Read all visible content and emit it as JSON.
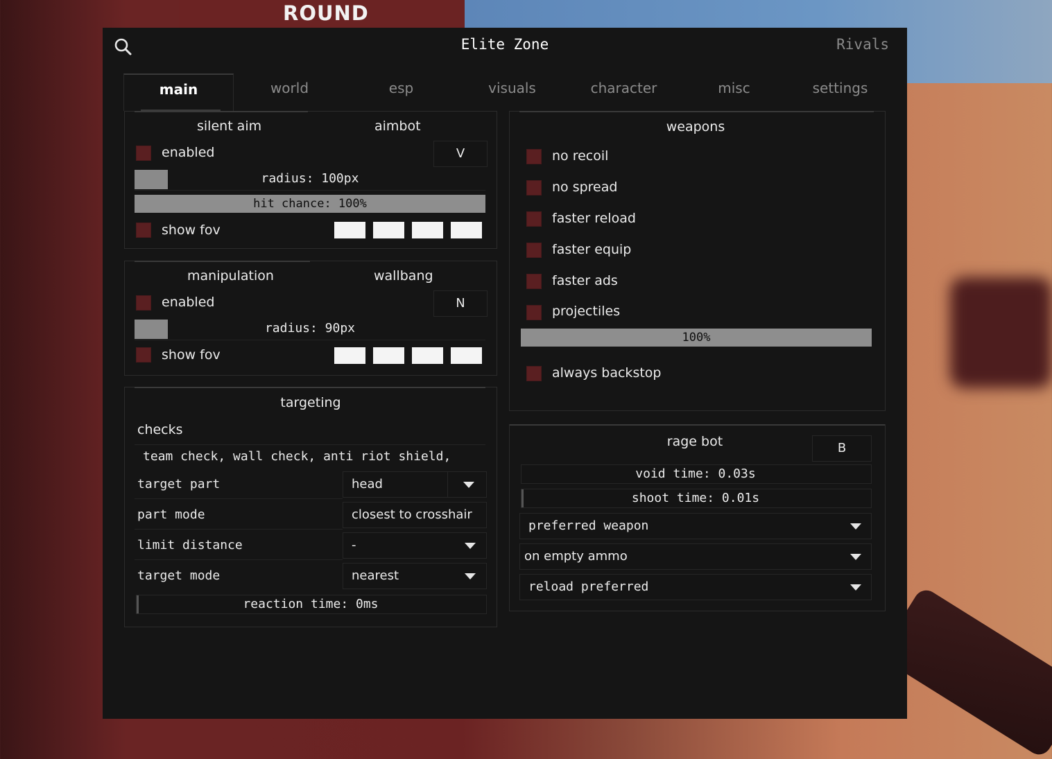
{
  "background": {
    "banner_text": "ROUND"
  },
  "window": {
    "title": "Elite Zone",
    "brand": "Rivals"
  },
  "tabs": [
    {
      "label": "main",
      "active": true
    },
    {
      "label": "world",
      "active": false
    },
    {
      "label": "esp",
      "active": false
    },
    {
      "label": "visuals",
      "active": false
    },
    {
      "label": "character",
      "active": false
    },
    {
      "label": "misc",
      "active": false
    },
    {
      "label": "settings",
      "active": false
    }
  ],
  "silent_aim": {
    "tab_left": "silent aim",
    "tab_right": "aimbot",
    "enabled_label": "enabled",
    "keybind": "V",
    "radius_label": "radius: 100px",
    "hit_chance_label": "hit chance: 100%",
    "hit_chance": 100,
    "show_fov_label": "show fov"
  },
  "manipulation": {
    "tab_left": "manipulation",
    "tab_right": "wallbang",
    "enabled_label": "enabled",
    "keybind": "N",
    "radius_label": "radius: 90px",
    "show_fov_label": "show fov"
  },
  "targeting": {
    "header": "targeting",
    "checks_label": "checks",
    "checks_value": "team check, wall check, anti riot shield,",
    "rows": [
      {
        "label": "target part",
        "value": "head",
        "dropdown": true
      },
      {
        "label": "part mode",
        "value": "closest to crosshair",
        "dropdown": false
      },
      {
        "label": "limit distance",
        "value": "-",
        "dropdown": true
      },
      {
        "label": "target mode",
        "value": "nearest",
        "dropdown": true
      }
    ],
    "reaction_time_label": "reaction time: 0ms"
  },
  "weapons": {
    "header": "weapons",
    "items": [
      "no recoil",
      "no spread",
      "faster reload",
      "faster equip",
      "faster ads",
      "projectiles"
    ],
    "percent_label": "100%",
    "percent": 100,
    "always_backstop_label": "always backstop"
  },
  "rage_bot": {
    "header": "rage bot",
    "keybind": "B",
    "void_time_label": "void time: 0.03s",
    "shoot_time_label": "shoot time: 0.01s",
    "dropdowns": [
      "preferred weapon",
      "on empty ammo",
      "reload preferred"
    ]
  },
  "colors": {
    "window_bg": "#151515",
    "checkbox": "#5a1f21",
    "slider_fill": "#8e8e8e",
    "accent_text": "#ececec"
  }
}
